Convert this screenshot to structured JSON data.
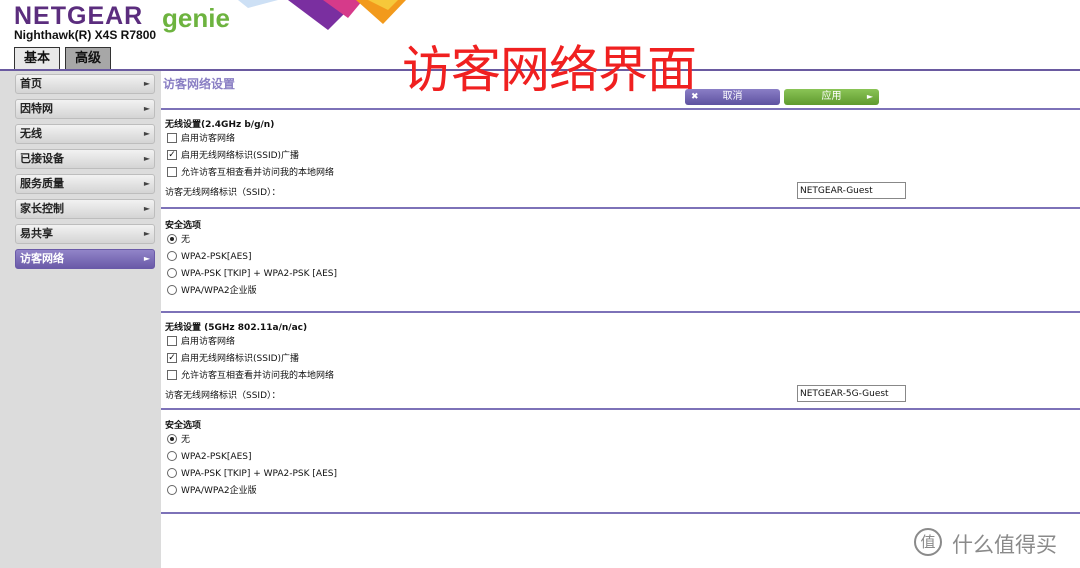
{
  "header": {
    "brand": "NETGEAR",
    "brand_suffix": "genie",
    "model": "Nighthawk(R) X4S R7800",
    "tabs": [
      {
        "label": "基本",
        "active": true
      },
      {
        "label": "高级",
        "active": false
      }
    ],
    "annotation": "访客网络界面"
  },
  "sidebar": {
    "items": [
      {
        "label": "首页",
        "active": false
      },
      {
        "label": "因特网",
        "active": false
      },
      {
        "label": "无线",
        "active": false
      },
      {
        "label": "已接设备",
        "active": false
      },
      {
        "label": "服务质量",
        "active": false
      },
      {
        "label": "家长控制",
        "active": false
      },
      {
        "label": "易共享",
        "active": false
      },
      {
        "label": "访客网络",
        "active": true
      }
    ],
    "arrow_glyph": "►"
  },
  "main": {
    "title": "访客网络设置",
    "cancel_label": "取消",
    "cancel_glyph": "✖",
    "apply_label": "应用",
    "apply_glyph": "►",
    "band24": {
      "title": "无线设置(2.4GHz b/g/n)",
      "options": [
        {
          "label": "启用访客网络",
          "checked": false
        },
        {
          "label": "启用无线网络标识(SSID)广播",
          "checked": true
        },
        {
          "label": "允许访客互相查看并访问我的本地网络",
          "checked": false
        }
      ],
      "ssid_label": "访客无线网络标识（SSID）：",
      "ssid_value": "NETGEAR-Guest",
      "security_title": "安全选项",
      "security_options": [
        {
          "label": "无",
          "selected": true
        },
        {
          "label": "WPA2-PSK[AES]",
          "selected": false
        },
        {
          "label": "WPA-PSK [TKIP] + WPA2-PSK [AES]",
          "selected": false
        },
        {
          "label": "WPA/WPA2企业版",
          "selected": false
        }
      ]
    },
    "band5": {
      "title": "无线设置 (5GHz 802.11a/n/ac)",
      "options": [
        {
          "label": "启用访客网络",
          "checked": false
        },
        {
          "label": "启用无线网络标识(SSID)广播",
          "checked": true
        },
        {
          "label": "允许访客互相查看并访问我的本地网络",
          "checked": false
        }
      ],
      "ssid_label": "访客无线网络标识（SSID）：",
      "ssid_value": "NETGEAR-5G-Guest",
      "security_title": "安全选项",
      "security_options": [
        {
          "label": "无",
          "selected": true
        },
        {
          "label": "WPA2-PSK[AES]",
          "selected": false
        },
        {
          "label": "WPA-PSK [TKIP] + WPA2-PSK [AES]",
          "selected": false
        },
        {
          "label": "WPA/WPA2企业版",
          "selected": false
        }
      ]
    }
  },
  "watermark": {
    "logo_glyph": "值",
    "text": "什么值得买"
  },
  "colors": {
    "accent_purple": "#6a5aa0",
    "brand_green": "#6db33f",
    "annotation_red": "#f02020"
  }
}
